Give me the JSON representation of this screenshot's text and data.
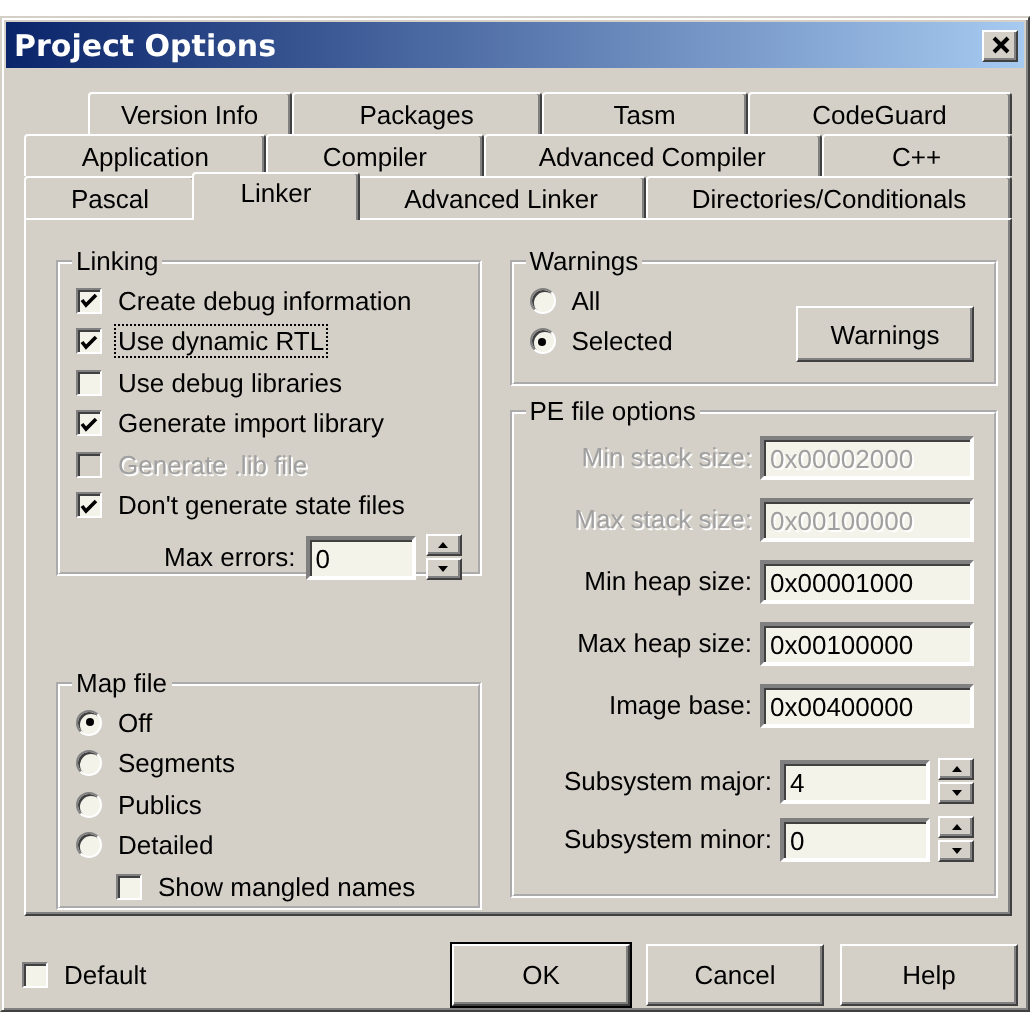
{
  "window": {
    "title": "Project Options"
  },
  "tab_rows": [
    [
      {
        "label": "Version Info",
        "selected": false
      },
      {
        "label": "Packages",
        "selected": false
      },
      {
        "label": "Tasm",
        "selected": false
      },
      {
        "label": "CodeGuard",
        "selected": false
      }
    ],
    [
      {
        "label": "Application",
        "selected": false
      },
      {
        "label": "Compiler",
        "selected": false
      },
      {
        "label": "Advanced Compiler",
        "selected": false
      },
      {
        "label": "C++",
        "selected": false
      }
    ],
    [
      {
        "label": "Pascal",
        "selected": false
      },
      {
        "label": "Linker",
        "selected": true
      },
      {
        "label": "Advanced Linker",
        "selected": false
      },
      {
        "label": "Directories/Conditionals",
        "selected": false
      }
    ]
  ],
  "linking": {
    "title": "Linking",
    "options": [
      {
        "label": "Create debug information",
        "checked": true,
        "disabled": false,
        "focused": false
      },
      {
        "label": "Use dynamic RTL",
        "checked": true,
        "disabled": false,
        "focused": true
      },
      {
        "label": "Use debug libraries",
        "checked": false,
        "disabled": false,
        "focused": false
      },
      {
        "label": "Generate import library",
        "checked": true,
        "disabled": false,
        "focused": false
      },
      {
        "label": "Generate .lib file",
        "checked": false,
        "disabled": true,
        "focused": false
      },
      {
        "label": "Don't generate state files",
        "checked": true,
        "disabled": false,
        "focused": false
      }
    ],
    "max_errors": {
      "label": "Max errors:",
      "value": "0"
    }
  },
  "map_file": {
    "title": "Map file",
    "options": [
      {
        "label": "Off",
        "selected": true
      },
      {
        "label": "Segments",
        "selected": false
      },
      {
        "label": "Publics",
        "selected": false
      },
      {
        "label": "Detailed",
        "selected": false
      }
    ],
    "show_mangled_names": {
      "label": "Show mangled names",
      "checked": false
    }
  },
  "warnings": {
    "title": "Warnings",
    "options": [
      {
        "label": "All",
        "selected": false
      },
      {
        "label": "Selected",
        "selected": true
      }
    ],
    "button": "Warnings"
  },
  "pe_file_options": {
    "title": "PE file options",
    "fields": [
      {
        "label": "Min stack size:",
        "value": "0x00002000",
        "disabled": true
      },
      {
        "label": "Max stack size:",
        "value": "0x00100000",
        "disabled": true
      },
      {
        "label": "Min heap size:",
        "value": "0x00001000",
        "disabled": false
      },
      {
        "label": "Max heap size:",
        "value": "0x00100000",
        "disabled": false
      },
      {
        "label": "Image base:",
        "value": "0x00400000",
        "disabled": false
      }
    ],
    "spinners": [
      {
        "label": "Subsystem major:",
        "value": "4"
      },
      {
        "label": "Subsystem minor:",
        "value": "0"
      }
    ]
  },
  "footer": {
    "default_option": {
      "label": "Default",
      "checked": false
    },
    "buttons": [
      {
        "label": "OK",
        "default": true
      },
      {
        "label": "Cancel",
        "default": false
      },
      {
        "label": "Help",
        "default": false
      }
    ]
  }
}
